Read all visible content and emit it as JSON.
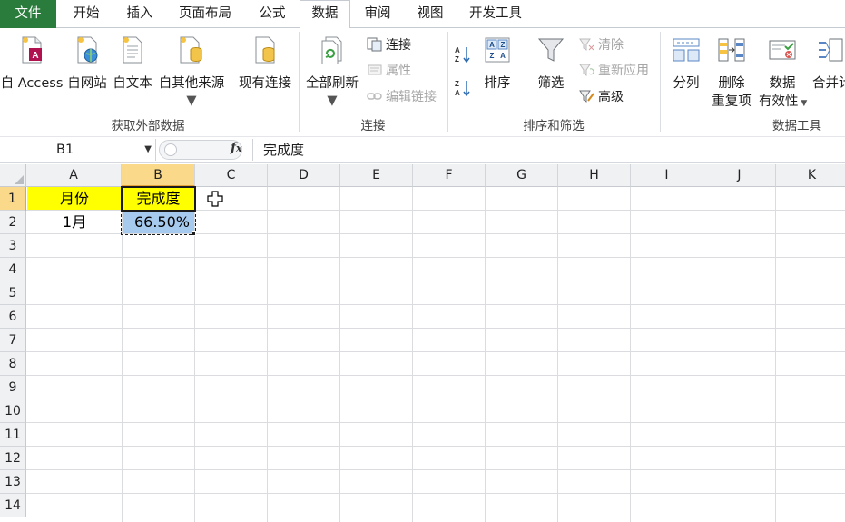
{
  "tabs": [
    {
      "label": "文件"
    },
    {
      "label": "开始"
    },
    {
      "label": "插入"
    },
    {
      "label": "页面布局"
    },
    {
      "label": "公式"
    },
    {
      "label": "数据"
    },
    {
      "label": "审阅"
    },
    {
      "label": "视图"
    },
    {
      "label": "开发工具"
    }
  ],
  "active_tab": "数据",
  "ribbon": {
    "get_external": {
      "label": "获取外部数据",
      "access": "自 Access",
      "web": "自网站",
      "text": "自文本",
      "other": "自其他来源",
      "existing": "现有连接"
    },
    "connections": {
      "label": "连接",
      "refresh_all": "全部刷新",
      "connections": "连接",
      "properties": "属性",
      "edit_links": "编辑链接"
    },
    "sort_filter": {
      "label": "排序和筛选",
      "sort": "排序",
      "filter": "筛选",
      "clear": "清除",
      "reapply": "重新应用",
      "advanced": "高级"
    },
    "data_tools": {
      "label": "数据工具",
      "text_to_columns": "分列",
      "remove_dup_1": "删除",
      "remove_dup_2": "重复项",
      "validation_1": "数据",
      "validation_2": "有效性",
      "consolidate": "合并计"
    }
  },
  "formula_bar": {
    "name_box": "B1",
    "fx": "fx",
    "content": "完成度"
  },
  "grid": {
    "columns": [
      "A",
      "B",
      "C",
      "D",
      "E",
      "F",
      "G",
      "H",
      "I",
      "J",
      "K"
    ],
    "rows": [
      "1",
      "2",
      "3",
      "4",
      "5",
      "6",
      "7",
      "8",
      "9",
      "10",
      "11",
      "12",
      "13",
      "14"
    ],
    "cells": {
      "A1": "月份",
      "B1": "完成度",
      "A2": "1月",
      "B2": "66.50%"
    },
    "highlight_color": "#ffff00",
    "selection_color": "#a6c9ee"
  }
}
